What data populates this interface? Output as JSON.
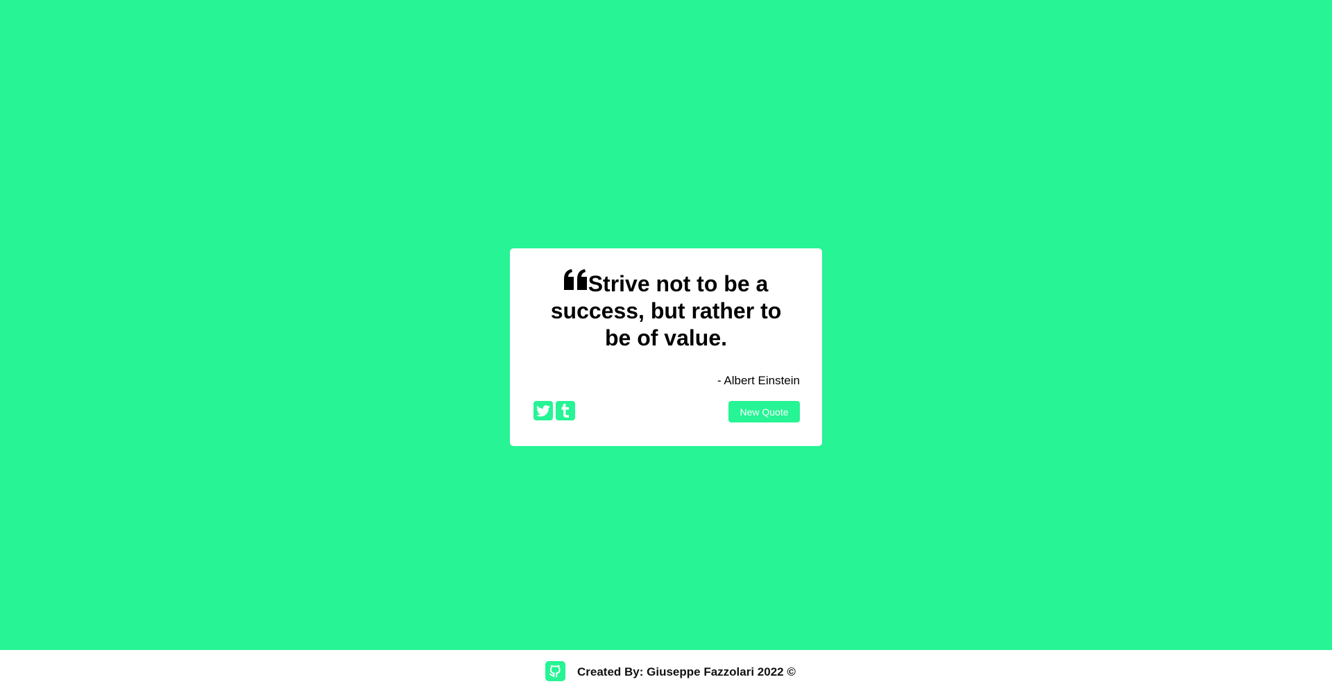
{
  "theme": {
    "accent": "#26f495",
    "card_bg": "#ffffff",
    "text": "#000000"
  },
  "quote": {
    "icon": "quote-left-icon",
    "text": "Strive not to be a success, but rather to be of value.",
    "author": "- Albert Einstein"
  },
  "actions": {
    "share": [
      {
        "icon": "twitter-icon"
      },
      {
        "icon": "tumblr-icon"
      }
    ],
    "new_quote_label": "New Quote"
  },
  "footer": {
    "icon": "github-icon",
    "credit": "Created By: Giuseppe Fazzolari 2022 ©"
  }
}
